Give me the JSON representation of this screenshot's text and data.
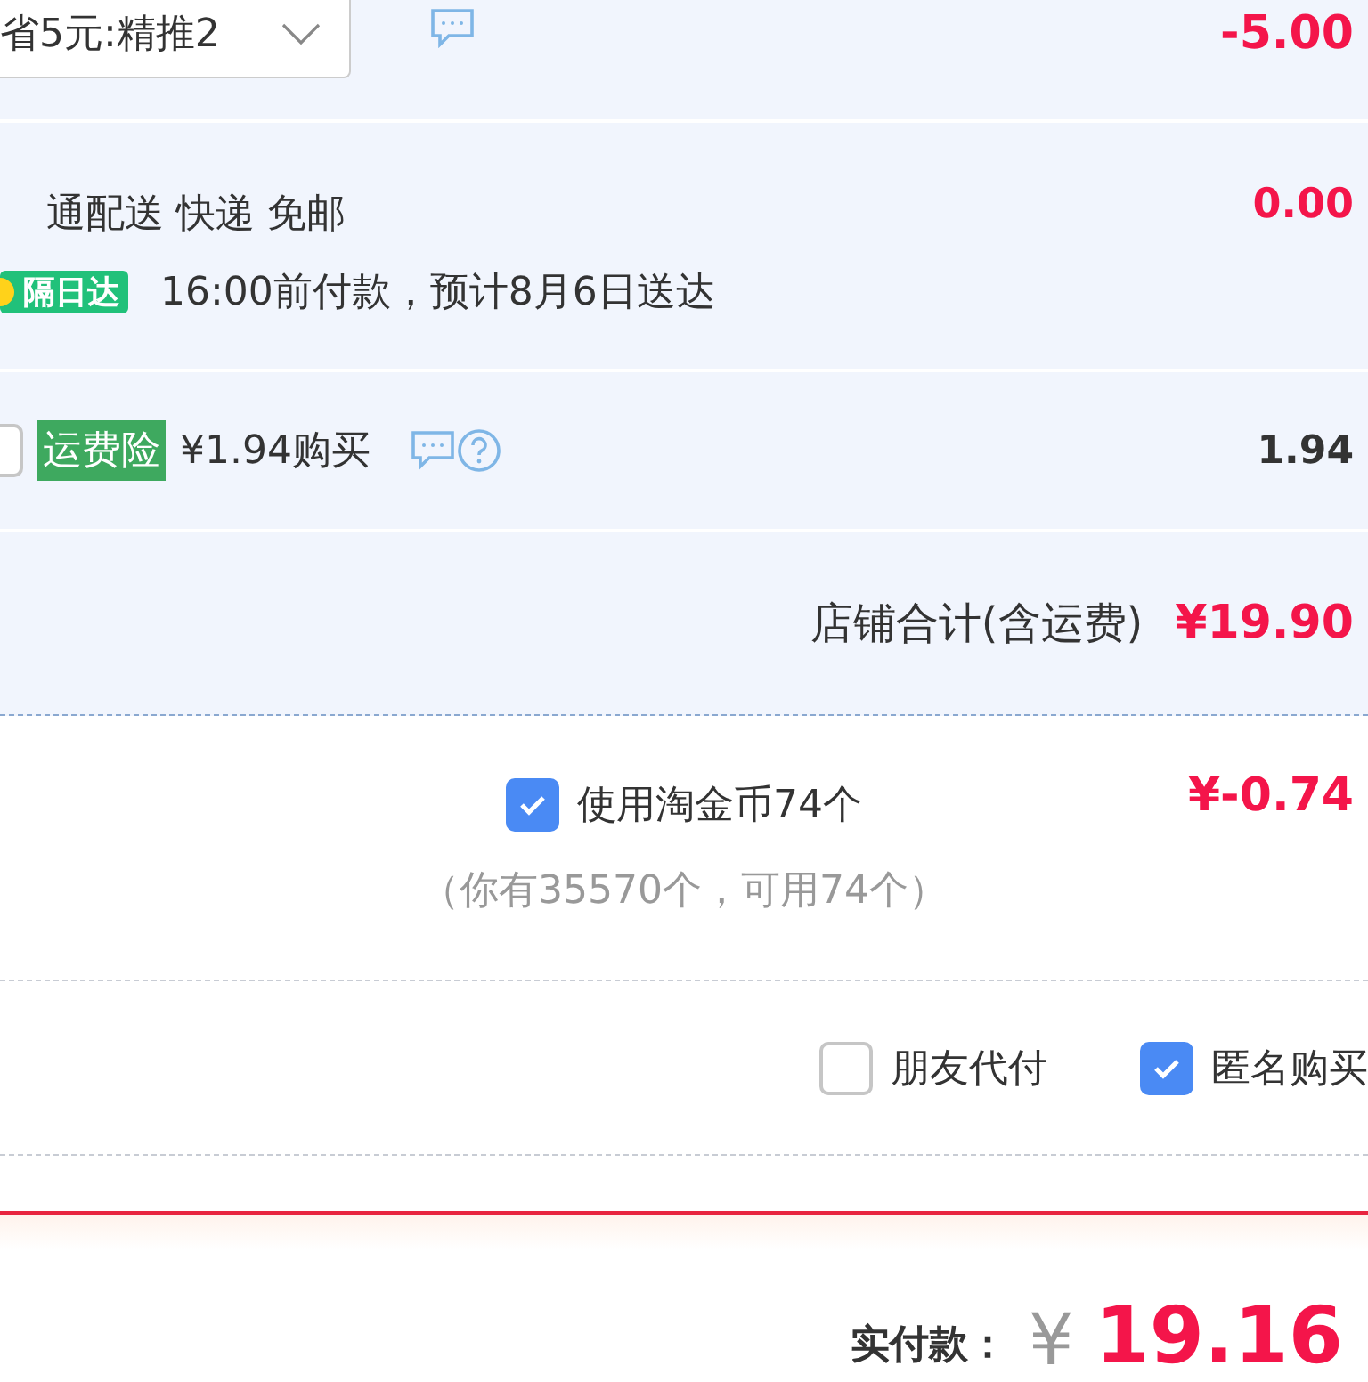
{
  "discount": {
    "dropdown": "省5元:精推2",
    "amount": "-5.00"
  },
  "shipping": {
    "method": "通配送 快递 免邮",
    "badge": "隔日达",
    "eta": "16:00前付款，预计8月6日送达",
    "amount": "0.00"
  },
  "insurance": {
    "checked": false,
    "tag": "运费险",
    "label": "¥1.94购买",
    "amount": "1.94"
  },
  "shop_total": {
    "label": "店铺合计(含运费)",
    "amount": "¥19.90"
  },
  "coins": {
    "checked": true,
    "label": "使用淘金币74个",
    "note": "（你有35570个，可用74个）",
    "amount": "¥-0.74"
  },
  "options": [
    {
      "label": "朋友代付",
      "checked": false
    },
    {
      "label": "匿名购买",
      "checked": true
    }
  ],
  "payment": {
    "label": "实付款：",
    "currency": "¥",
    "amount": "19.16"
  }
}
